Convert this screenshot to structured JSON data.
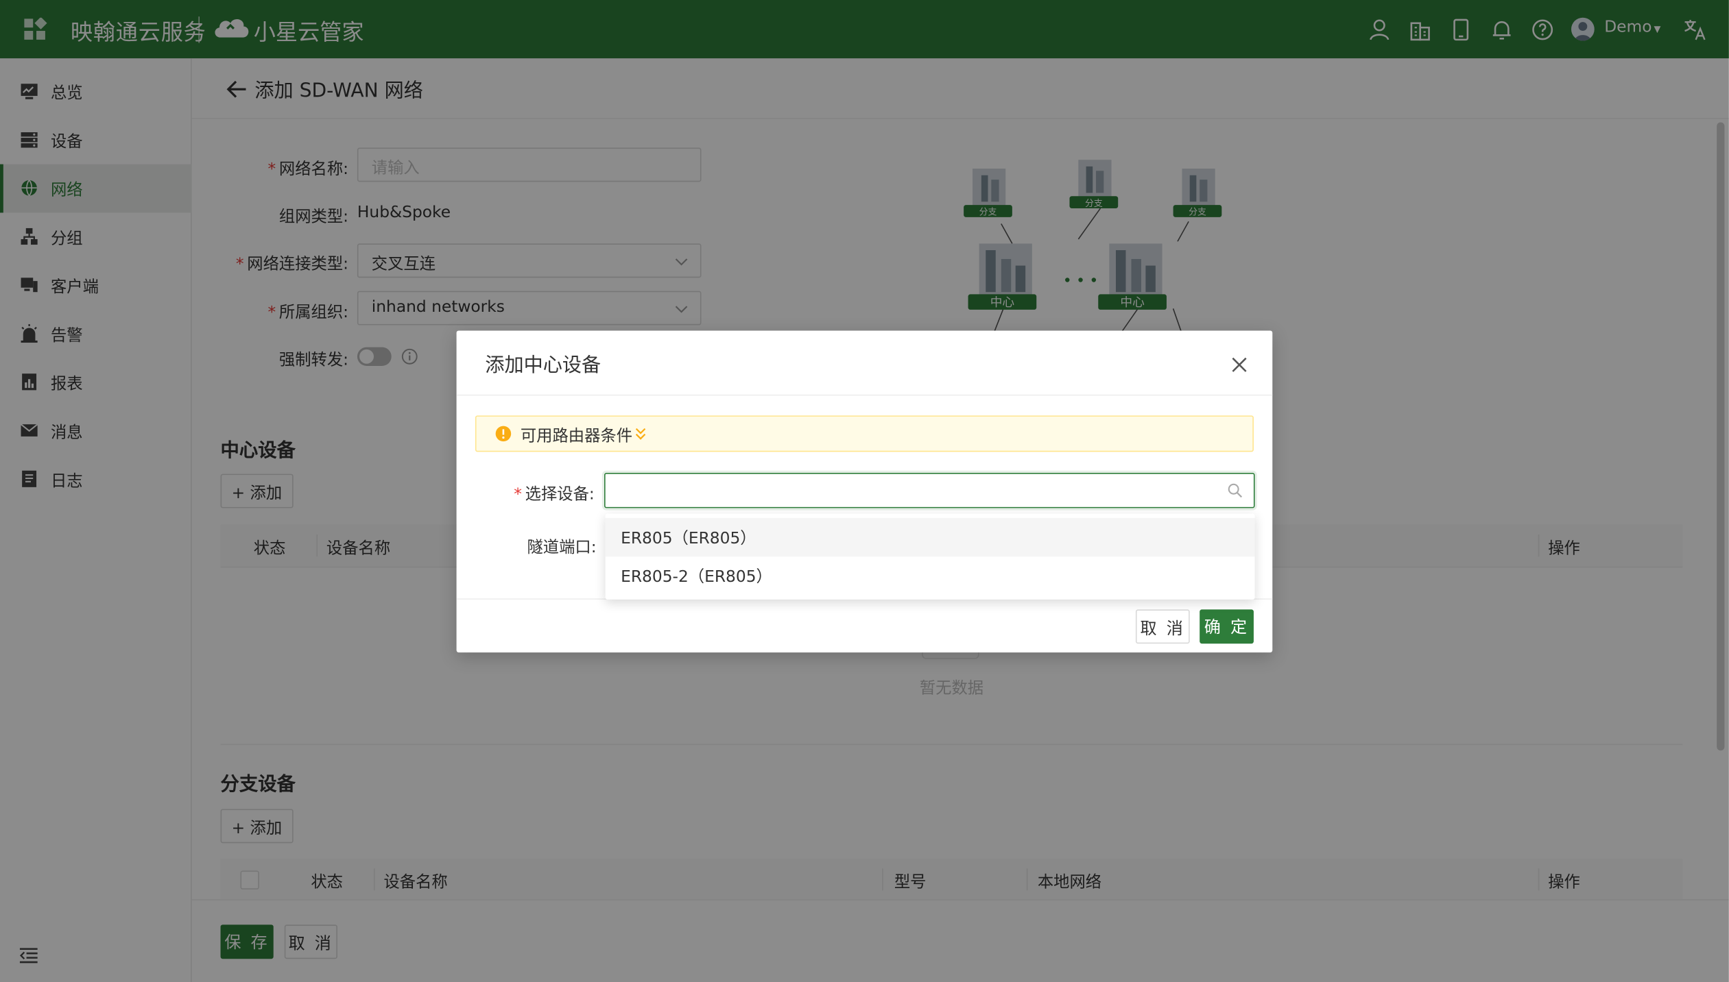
{
  "header": {
    "brand": "映翰通云服务",
    "brand_secondary": "小星云管家",
    "user_name": "Demo",
    "icons": [
      "apps-icon",
      "user-icon",
      "building-icon",
      "tablet-icon",
      "bell-icon",
      "help-icon",
      "translate-icon"
    ]
  },
  "sidebar": {
    "items": [
      {
        "label": "总览",
        "icon": "dashboard-icon"
      },
      {
        "label": "设备",
        "icon": "device-icon"
      },
      {
        "label": "网络",
        "icon": "globe-icon",
        "active": true
      },
      {
        "label": "分组",
        "icon": "group-icon"
      },
      {
        "label": "客户端",
        "icon": "client-icon"
      },
      {
        "label": "告警",
        "icon": "alarm-icon"
      },
      {
        "label": "报表",
        "icon": "report-icon"
      },
      {
        "label": "消息",
        "icon": "mail-icon"
      },
      {
        "label": "日志",
        "icon": "log-icon"
      }
    ]
  },
  "page": {
    "title": "添加 SD-WAN 网络",
    "form": {
      "name_label": "网络名称:",
      "name_placeholder": "请输入",
      "type_label": "组网类型:",
      "type_value": "Hub&Spoke",
      "conn_label": "网络连接类型:",
      "conn_value": "交叉互连",
      "org_label": "所属组织:",
      "org_value": "inhand networks",
      "force_label": "强制转发:",
      "required_mark": "*"
    },
    "diagram": {
      "branch_label": "分支",
      "center_label": "中心"
    },
    "hub_section": {
      "title": "中心设备",
      "add_label": "+ 添加",
      "columns": [
        "状态",
        "设备名称",
        "操作"
      ],
      "empty_text": "暂无数据"
    },
    "spoke_section": {
      "title": "分支设备",
      "add_label": "+ 添加",
      "columns": [
        "状态",
        "设备名称",
        "型号",
        "本地网络",
        "操作"
      ]
    },
    "footer": {
      "save_label": "保 存",
      "cancel_label": "取 消"
    }
  },
  "modal": {
    "title": "添加中心设备",
    "alert_text": "可用路由器条件",
    "select_label": "选择设备:",
    "tunnel_label": "隧道端口:",
    "options": [
      "ER805（ER805）",
      "ER805-2（ER805）"
    ],
    "cancel_label": "取 消",
    "ok_label": "确 定"
  },
  "colors": {
    "brand_green": "#2e7d3a",
    "warning": "#faad14",
    "required": "#e53935"
  }
}
